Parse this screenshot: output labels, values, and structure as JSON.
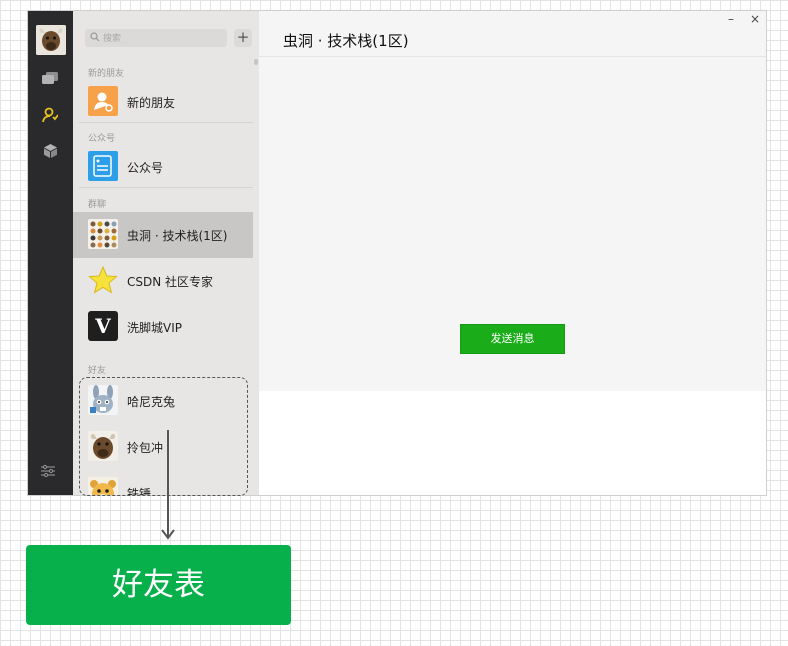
{
  "window": {
    "title": "虫洞 · 技术栈(1区)",
    "minimize_glyph": "–",
    "close_glyph": "×"
  },
  "sidebar": {
    "nav_icons": [
      "chat-icon",
      "contacts-icon",
      "box-icon"
    ],
    "active_nav": "contacts-icon",
    "settings_icon": "settings-icon"
  },
  "search": {
    "placeholder": "搜索",
    "add_label": "+"
  },
  "sections": {
    "new_friends": "新的朋友",
    "official": "公众号",
    "groups": "群聊",
    "friends": "好友"
  },
  "items": {
    "new_friends": "新的朋友",
    "official": "公众号",
    "group1": "虫洞 · 技术栈(1区)",
    "group2": "CSDN 社区专家",
    "group3": "洗脚城VIP",
    "friend1": "哈尼克兔",
    "friend2": "拎包冲",
    "friend3": "铁锤"
  },
  "vip_logo_letter": "V",
  "main": {
    "send_button": "发送消息"
  },
  "annotation": {
    "label": "好友表"
  },
  "colors": {
    "accent_green": "#1aad19",
    "annotation_green": "#07b04a",
    "rail_dark": "#2a2a2d",
    "active_nav_yellow": "#e8c21f"
  }
}
